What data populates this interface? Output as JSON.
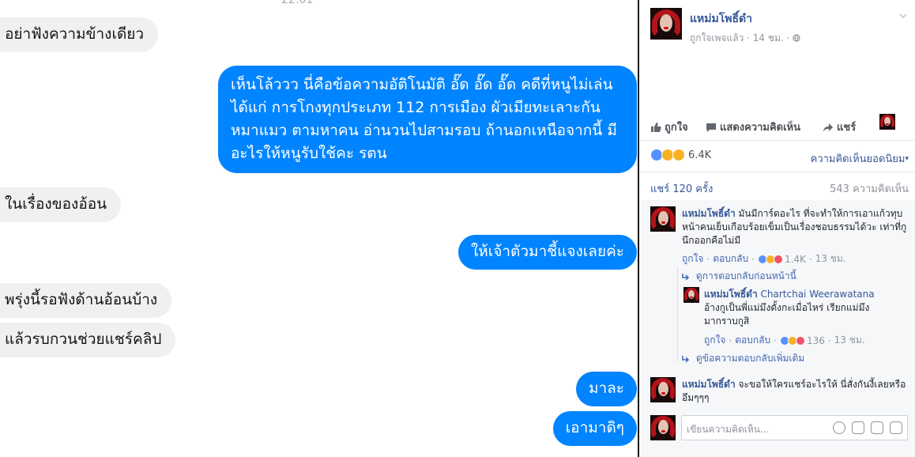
{
  "chat": {
    "time": "22:01",
    "messages": [
      {
        "side": "in",
        "text": "อย่าฟังความข้างเดียว"
      },
      {
        "side": "out",
        "text": "เห็นโล้ววว นี่คือข้อความอัติโนมัติ อั๊ด อั๊ด อั๊ด คดีที่หนูไม่เล่น ได้แก่ การโกงทุกประเภท 112 การเมือง ผัวเมียทะเลาะกัน หมาแมว ตามหาคน อ่านวนไปสามรอบ ถ้านอกเหนือจากนี้ มีอะไรให้หนูรับใช้คะ รตน"
      },
      {
        "side": "in",
        "text": "ในเรื่องของอ้อน"
      },
      {
        "side": "out",
        "text": "ให้เจ้าตัวมาชี้แจงเลยค่ะ"
      },
      {
        "side": "in",
        "text": "พรุ่งนี้รอฟังด้านอ้อนบ้าง"
      },
      {
        "side": "in",
        "text": "แล้วรบกวนช่วยแชร์คลิป"
      },
      {
        "side": "out",
        "text": "มาละ"
      },
      {
        "side": "out",
        "text": "เอามาดิๆ"
      }
    ]
  },
  "post": {
    "page_name": "แหม่มโพธิ์ดำ",
    "meta": "ถูกใจเพจแล้ว · 14 ชม. ·",
    "actions": {
      "like": "ถูกใจ",
      "comment": "แสดงความคิดเห็น",
      "share": "แชร์"
    },
    "reaction_count": "6.4K",
    "top_comments": "ความคิดเห็นยอดนิยม",
    "shares": "แชร์ 120 ครั้ง",
    "comment_count": "543 ความคิดเห็น"
  },
  "comments": [
    {
      "author": "แหม่มโพธิ์ดำ",
      "text": "มันมีการ์ดอะไร ที่จะทำให้การเอาแก้วทุบหน้าคนเย็บเกือบร้อยเข็มเป็นเรื่องชอบธรรมได้วะ เท่าที่กูนึกออกคือไม่มี",
      "like": "ถูกใจ",
      "reply": "ตอบกลับ",
      "reactions": "1.4K",
      "time": "13 ชม.",
      "prev_replies": "ดูการตอบกลับก่อนหน้านี้"
    },
    {
      "author": "แหม่มโพธิ์ดำ",
      "mention": "Chartchai Weerawatana",
      "text": "อ้างกูเป็นพี่แม่มึงดั้งกะเมื่อไหร่ เรียกแม่มึงมากราบกูสิ",
      "like": "ถูกใจ",
      "reply": "ตอบกลับ",
      "reactions": "136",
      "time": "13 ชม.",
      "more_replies": "ดูข้อความตอบกลับเพิ่มเติม"
    },
    {
      "author": "แหม่มโพธิ์ดำ",
      "text": "จะขอให้ใครแชร์อะไรให้ นี่สั่งกันงี้เลยหรือ อึมๆๆๆ"
    }
  ],
  "comment_input": {
    "placeholder": "เขียนความคิดเห็น..."
  },
  "colors": {
    "messenger_blue": "#0084ff",
    "incoming_gray": "#f0f0f0",
    "fb_link": "#365899"
  }
}
